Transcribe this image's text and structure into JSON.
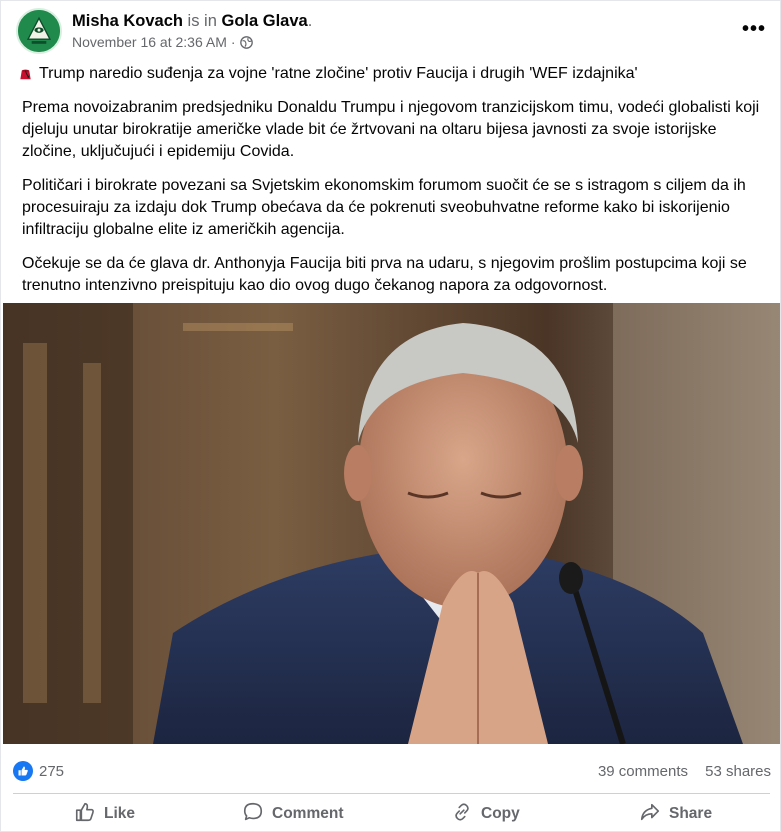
{
  "post": {
    "author": "Misha Kovach",
    "is_in": "is in",
    "group": "Gola Glava",
    "group_suffix": ".",
    "timestamp": "November 16 at 2:36 AM",
    "meta_separator": "·",
    "more_label": "•••",
    "headline": "Trump naredio suđenja za vojne 'ratne zločine' protiv Faucija i drugih 'WEF izdajnika'",
    "paragraphs": [
      "Prema novoizabranim predsjedniku Donaldu Trumpu i njegovom tranzicijskom timu, vodeći globalisti koji djeluju unutar birokratije američke vlade bit će žrtvovani na oltaru bijesa javnosti za svoje istorijske zločine, uključujući i epidemiju Covida.",
      "Političari i birokrate povezani sa Svjetskim ekonomskim forumom suočit će se s istragom s ciljem da ih procesuiraju za izdaju dok Trump obećava da će pokrenuti sveobuhvatne reforme kako bi iskorijenio infiltraciju globalne elite iz američkih agencija.",
      "Očekuje se da će glava dr. Anthonyja Faucija biti prva na udaru, s njegovim prošlim postupcima koji se trenutno intenzivno preispituju kao dio ovog dugo čekanog napora za odgovornost."
    ]
  },
  "stats": {
    "reactions": "275",
    "comments": "39 comments",
    "shares": "53 shares"
  },
  "actions": {
    "like": "Like",
    "comment": "Comment",
    "copy": "Copy",
    "share": "Share"
  },
  "icons": {
    "avatar": "avatar-pyramid-icon",
    "privacy": "globe-icon",
    "headline_emoji": "fez-icon",
    "reaction": "thumbs-up-icon"
  },
  "colors": {
    "facebook_blue": "#1877f2",
    "secondary_text": "#65676b",
    "avatar_green": "#1f8a4c",
    "fez_red": "#c8102e"
  }
}
